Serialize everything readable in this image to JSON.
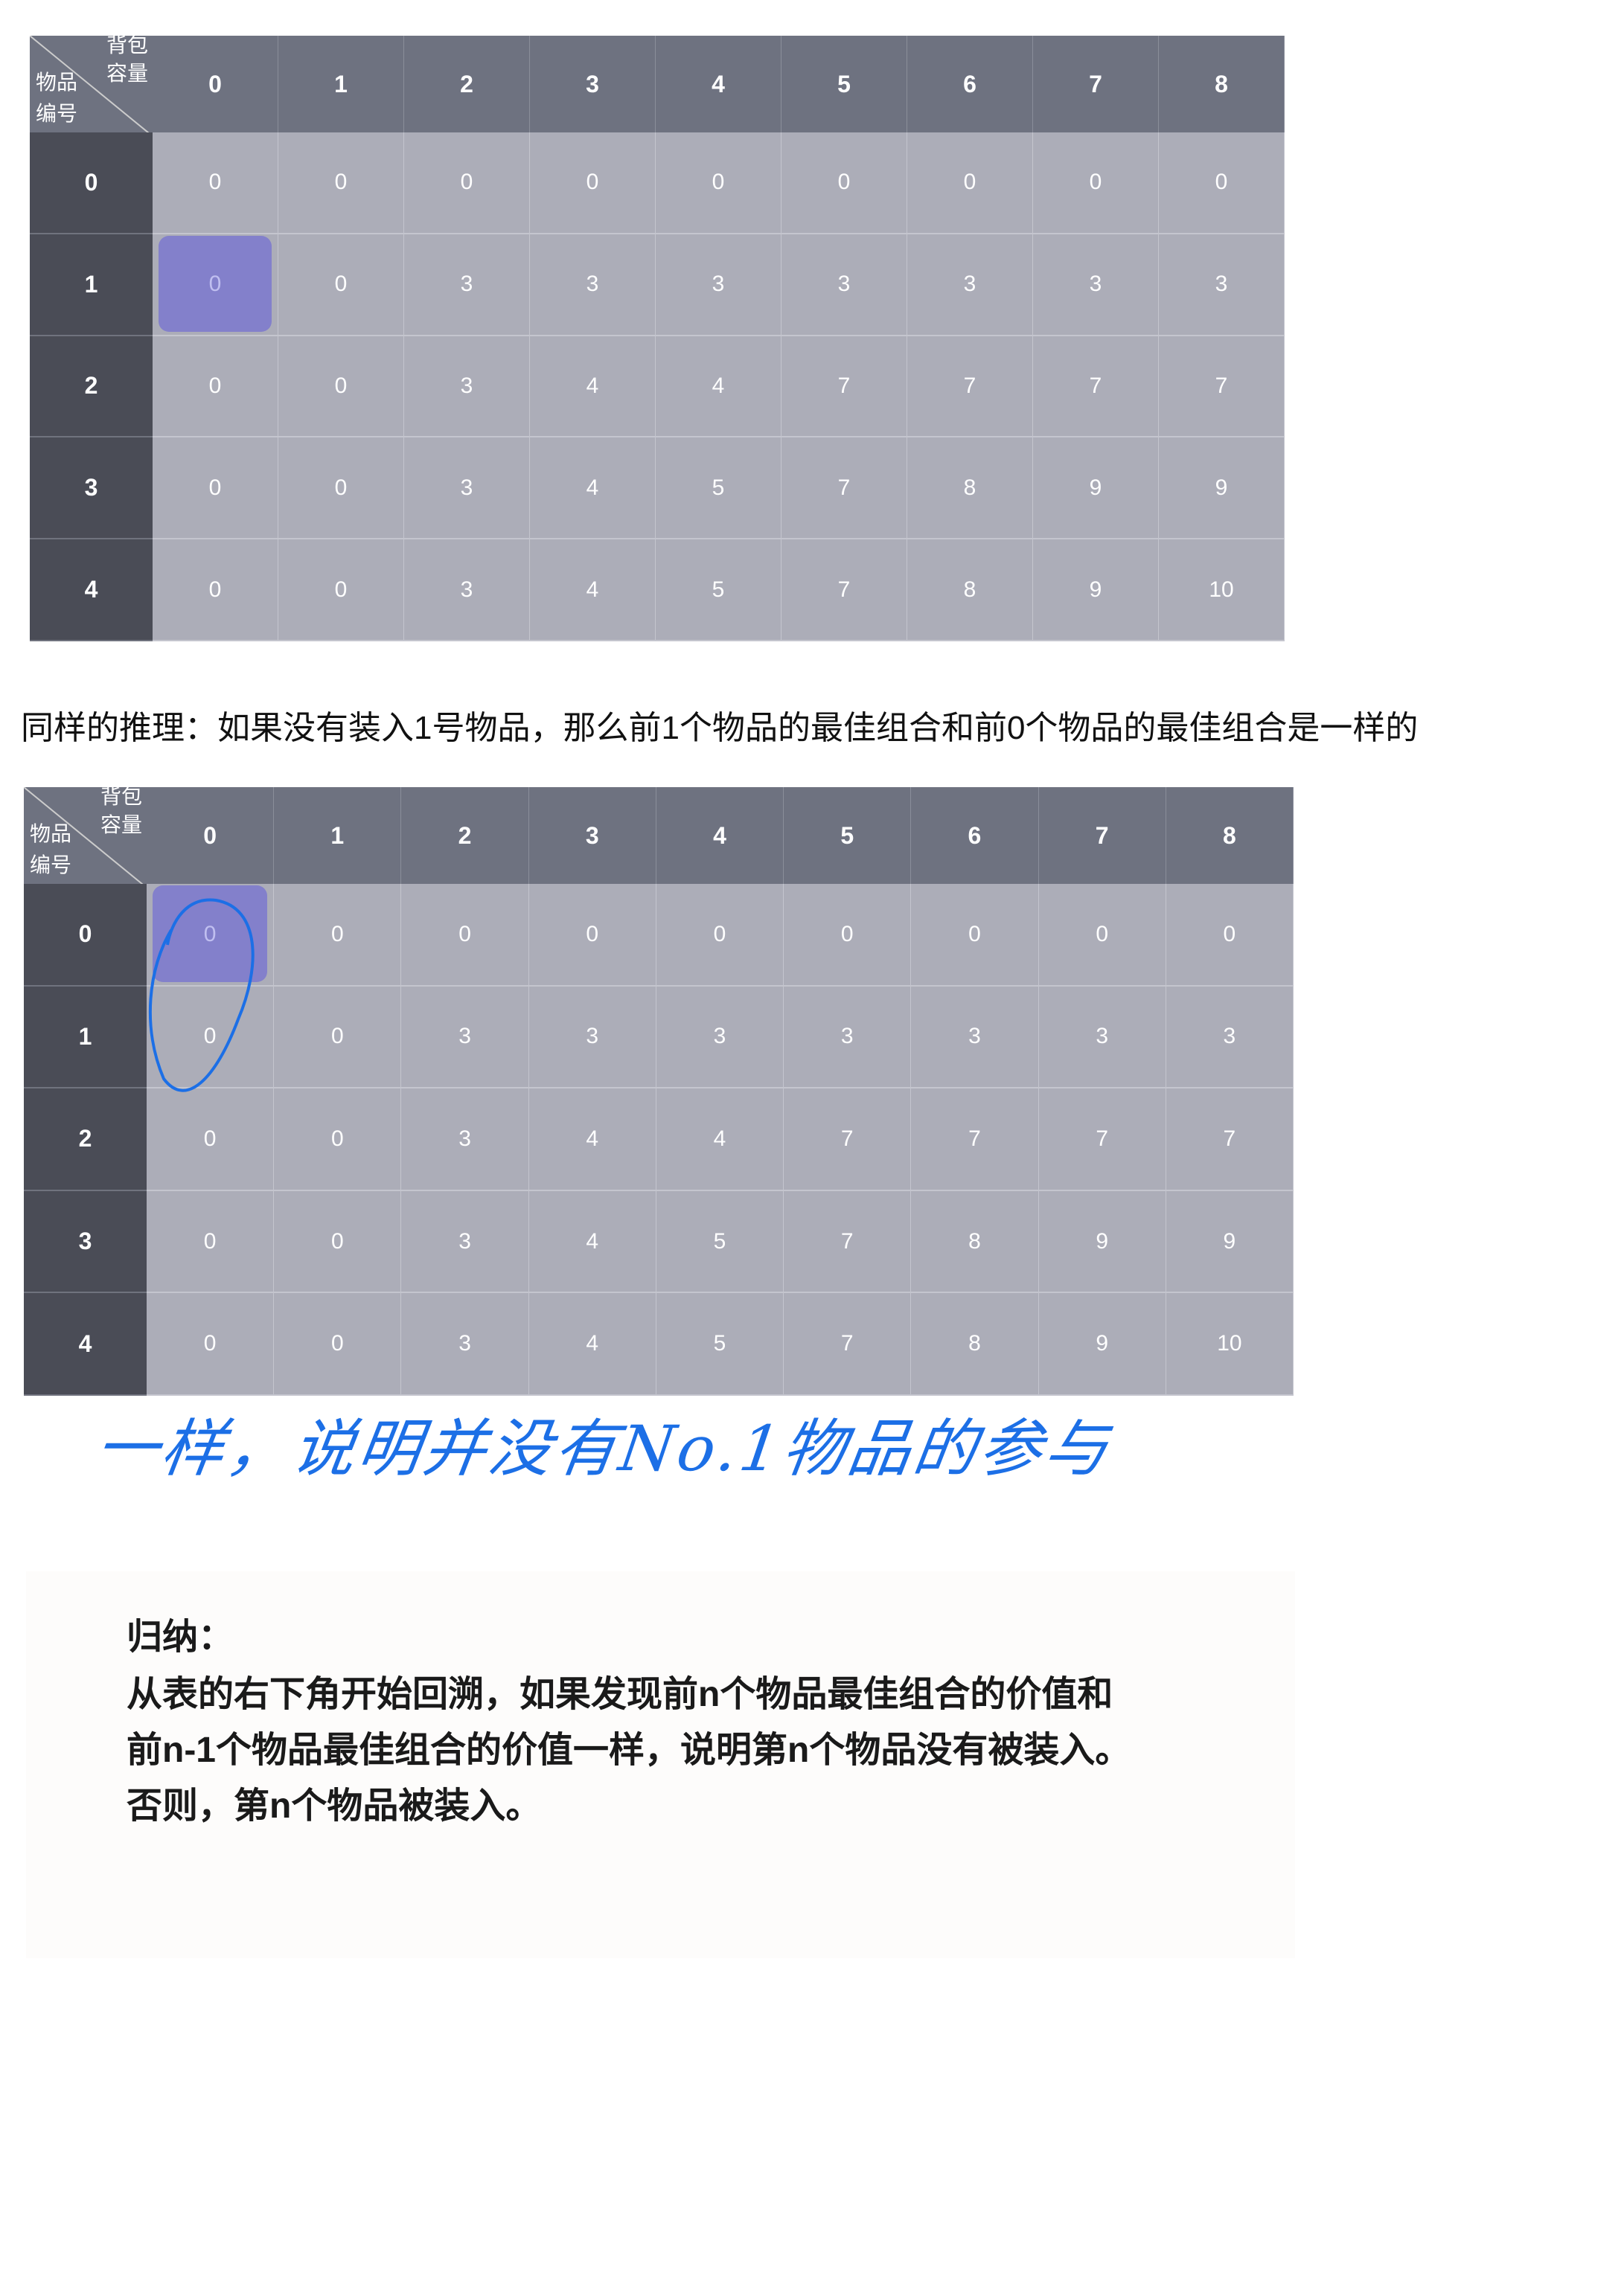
{
  "table": {
    "corner_top": [
      "背包",
      "容量"
    ],
    "corner_bottom": [
      "物品",
      "编号"
    ],
    "capacities": [
      "0",
      "1",
      "2",
      "3",
      "4",
      "5",
      "6",
      "7",
      "8"
    ],
    "items": [
      "0",
      "1",
      "2",
      "3",
      "4"
    ],
    "values": [
      [
        "0",
        "0",
        "0",
        "0",
        "0",
        "0",
        "0",
        "0",
        "0"
      ],
      [
        "0",
        "0",
        "3",
        "3",
        "3",
        "3",
        "3",
        "3",
        "3"
      ],
      [
        "0",
        "0",
        "3",
        "4",
        "4",
        "7",
        "7",
        "7",
        "7"
      ],
      [
        "0",
        "0",
        "3",
        "4",
        "5",
        "7",
        "8",
        "9",
        "9"
      ],
      [
        "0",
        "0",
        "3",
        "4",
        "5",
        "7",
        "8",
        "9",
        "10"
      ]
    ]
  },
  "table1_highlight": [
    1,
    0
  ],
  "table2_highlight": [
    0,
    0
  ],
  "sentence": "同样的推理：如果没有装入1号物品，那么前1个物品的最佳组合和前0个物品的最佳组合是一样的",
  "handwritten_note": "一样，说明并没有No.1物品的参与",
  "annotation_color": "#1c6fe6",
  "summary": {
    "title": "归纳：",
    "lines": [
      "从表的右下角开始回溯，如果发现前n个物品最佳组合的价值和",
      "前n-1个物品最佳组合的价值一样，说明第n个物品没有被装入。",
      "否则，第n个物品被装入。"
    ]
  }
}
